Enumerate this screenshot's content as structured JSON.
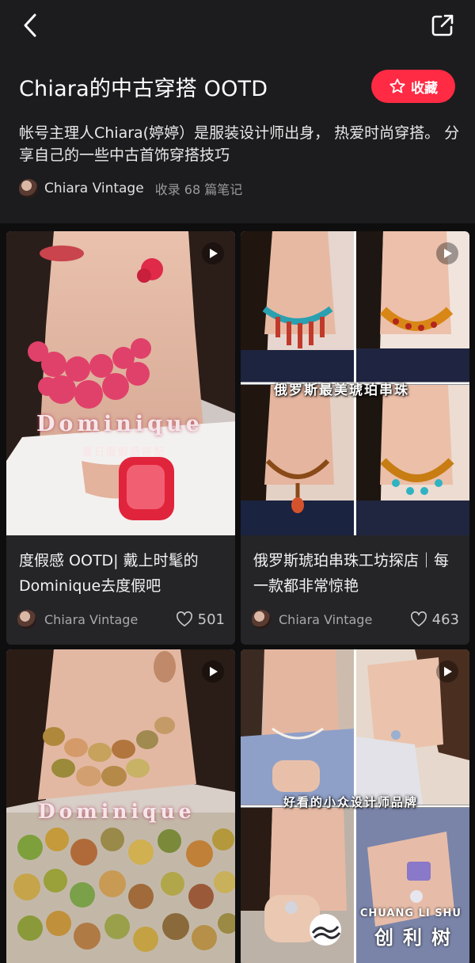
{
  "header": {
    "title": "Chiara的中古穿搭 OOTD",
    "favorite_label": "收藏",
    "description": "帐号主理人Chiara(婷婷）是服装设计师出身， 热爱时尚穿搭。 分享自己的一些中古首饰穿搭技巧",
    "author": "Chiara Vintage",
    "note_count": "收录 68 篇笔记"
  },
  "colors": {
    "accent": "#ff2a43",
    "background": "#1c1c1e",
    "card": "#252528"
  },
  "cards": [
    {
      "title": "度假感 OOTD| 戴上时髦的Dominique去度假吧",
      "author": "Chiara Vintage",
      "likes": "501",
      "overlay_text": "Dominique",
      "overlay_sub": "夏日度假感搭配",
      "icon": "play-icon"
    },
    {
      "title": "俄罗斯琥珀串珠工坊探店｜每一款都非常惊艳",
      "author": "Chiara Vintage",
      "likes": "463",
      "overlay_text": "俄罗斯最美琥珀串珠",
      "icon": "play-icon"
    },
    {
      "overlay_text": "Dominique",
      "icon": "play-icon"
    },
    {
      "overlay_text": "好看的小众设计师品牌",
      "icon": "play-icon"
    }
  ],
  "watermark": {
    "en": "CHUANG LI SHU",
    "cn": "创利树"
  }
}
